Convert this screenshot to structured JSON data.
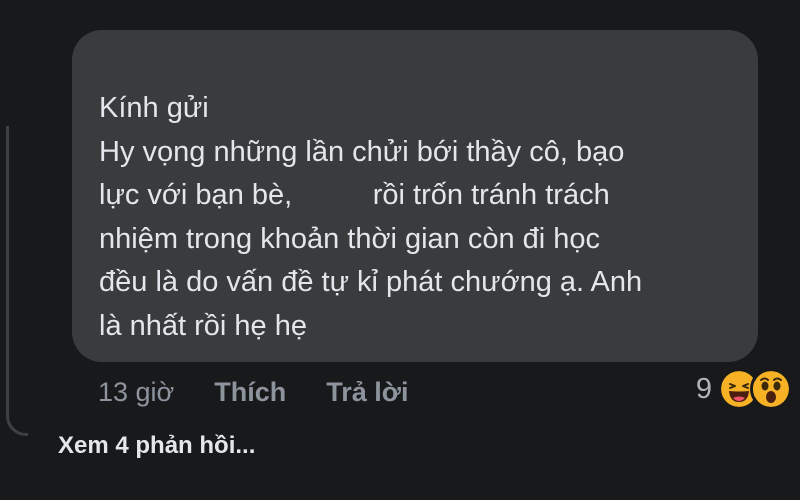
{
  "comment": {
    "text": "Kính gửi\nHy vọng những lần chửi bới thầy cô, bạo\nlực với bạn bè,          rồi trốn tránh trách\nnhiệm trong khoản thời gian còn đi học\nđều là do vấn đề tự kỉ phát chướng ạ. Anh\nlà nhất rồi hẹ hẹ",
    "timestamp": "13 giờ",
    "like_label": "Thích",
    "reply_label": "Trả lời",
    "reaction_count": "9",
    "reactions": [
      "haha-icon",
      "wow-icon"
    ]
  },
  "replies": {
    "label": "Xem 4 phản hồi..."
  },
  "colors": {
    "background": "#18191a",
    "bubble": "#3a3b3c",
    "text_primary": "#e4e6eb",
    "text_secondary": "#8d949e",
    "reaction_yellow": "#f7b125"
  }
}
